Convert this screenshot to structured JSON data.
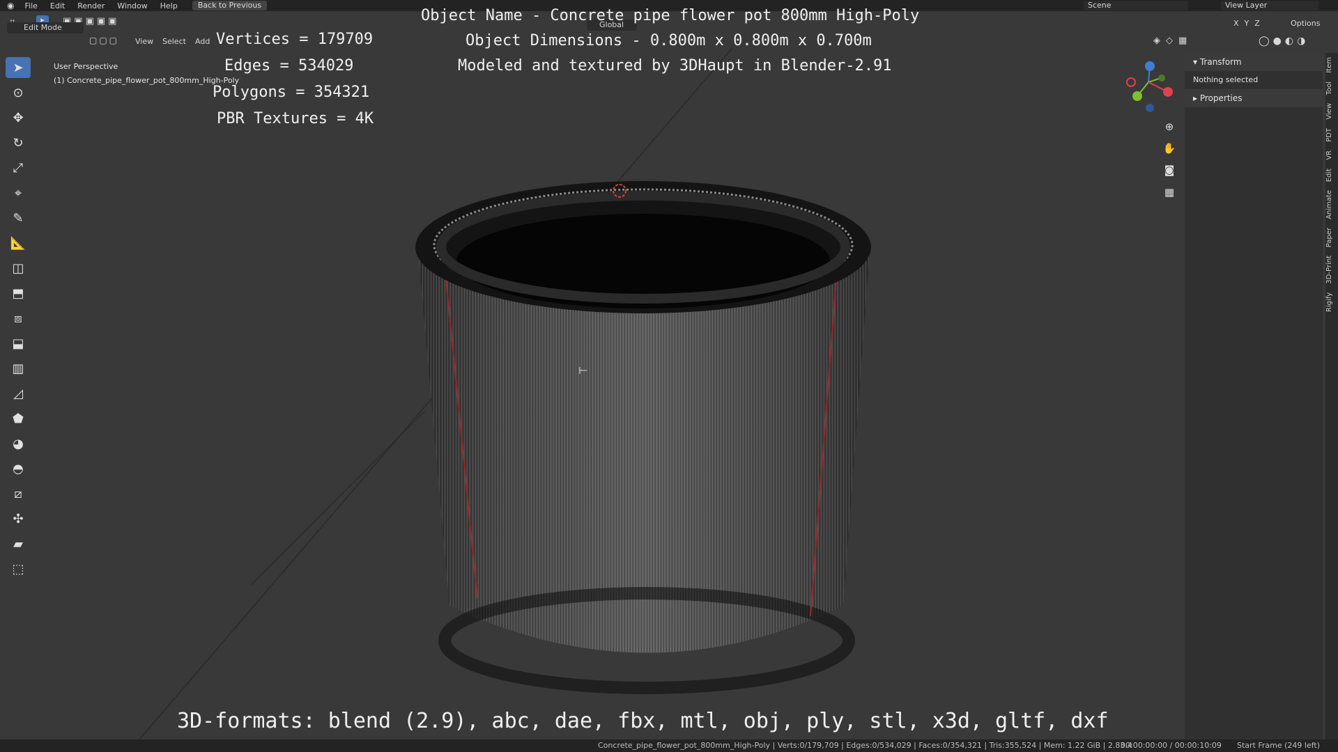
{
  "topbar": {
    "menus": [
      "File",
      "Edit",
      "Render",
      "Window",
      "Help"
    ],
    "back_button": "Back to Previous",
    "scene": "Scene",
    "view_layer": "View Layer"
  },
  "header": {
    "mode": "Edit Mode",
    "menus": [
      "View",
      "Select",
      "Add"
    ],
    "orientation": "Global",
    "options": "Options",
    "axes": [
      "X",
      "Y",
      "Z"
    ]
  },
  "overlay": {
    "title": "Object Name - Concrete pipe flower pot 800mm High-Poly",
    "dimensions": "Object Dimensions -  0.800m x 0.800m x 0.700m",
    "credit": "Modeled and textured by 3DHaupt in Blender-2.91",
    "vertices": "Vertices = 179709",
    "edges": "Edges = 534029",
    "polygons": "Polygons = 354321",
    "textures": "PBR Textures = 4K",
    "formats": "3D-formats: blend (2.9), abc, dae, fbx, mtl, obj, ply, stl, x3d, gltf, dxf"
  },
  "viewport": {
    "perspective": "User Perspective",
    "object": "(1) Concrete_pipe_flower_pot_800mm_High-Poly"
  },
  "npanel": {
    "transform": "Transform",
    "nothing_selected": "Nothing selected",
    "properties": "Properties",
    "tabs": [
      "Item",
      "Tool",
      "View",
      "PDT",
      "VR",
      "Edit",
      "Animate",
      "Paper",
      "3D-Print",
      "Rigify"
    ]
  },
  "status": {
    "info": "Concrete_pipe_flower_pot_800mm_High-Poly | Verts:0/179,709 | Edges:0/534,029 | Faces:0/354,321 | Tris:355,524 | Mem: 1.22 GiB | 2.83.4",
    "time": "00:00:00:00 / 00:00:10:09",
    "frame": "Start Frame (249 left)"
  },
  "colors": {
    "viewport_bg": "#393939",
    "active_tool": "#4772b3",
    "axis_x": "#e0414f",
    "axis_y": "#7fbf2f",
    "axis_z": "#3d7fd6"
  }
}
